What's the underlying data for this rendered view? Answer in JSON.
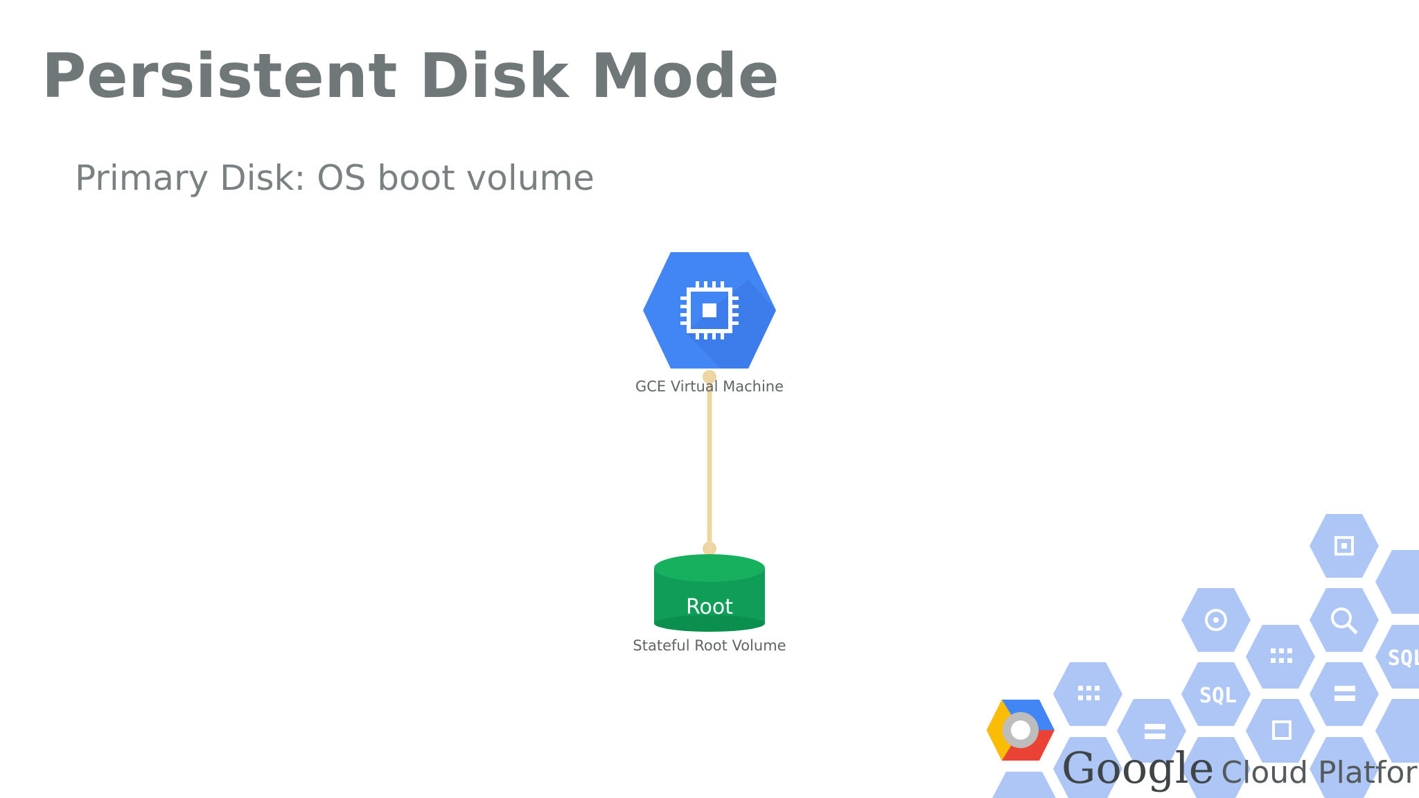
{
  "slide": {
    "title": "Persistent Disk Mode",
    "subtitle": "Primary Disk: OS boot volume"
  },
  "diagram": {
    "nodes": [
      {
        "id": "vm",
        "icon": "compute-engine-hexagon-icon",
        "caption": "GCE Virtual Machine"
      },
      {
        "id": "root",
        "icon": "disk-cylinder-icon",
        "label": "Root",
        "caption": "Stateful Root Volume"
      }
    ],
    "edges": [
      {
        "from": "vm",
        "to": "root"
      }
    ]
  },
  "branding": {
    "google": "Google",
    "cloud_platform": "Cloud Platform",
    "logo_icon": "google-cloud-platform-logo-icon",
    "decor_labels": [
      "SQL",
      "SQL"
    ]
  },
  "colors": {
    "title": "#6f7778",
    "vm_blue": "#4285f4",
    "disk_green": "#0f9d58",
    "connector": "#ecd6a3",
    "decor_hex": "#aec6f5"
  }
}
